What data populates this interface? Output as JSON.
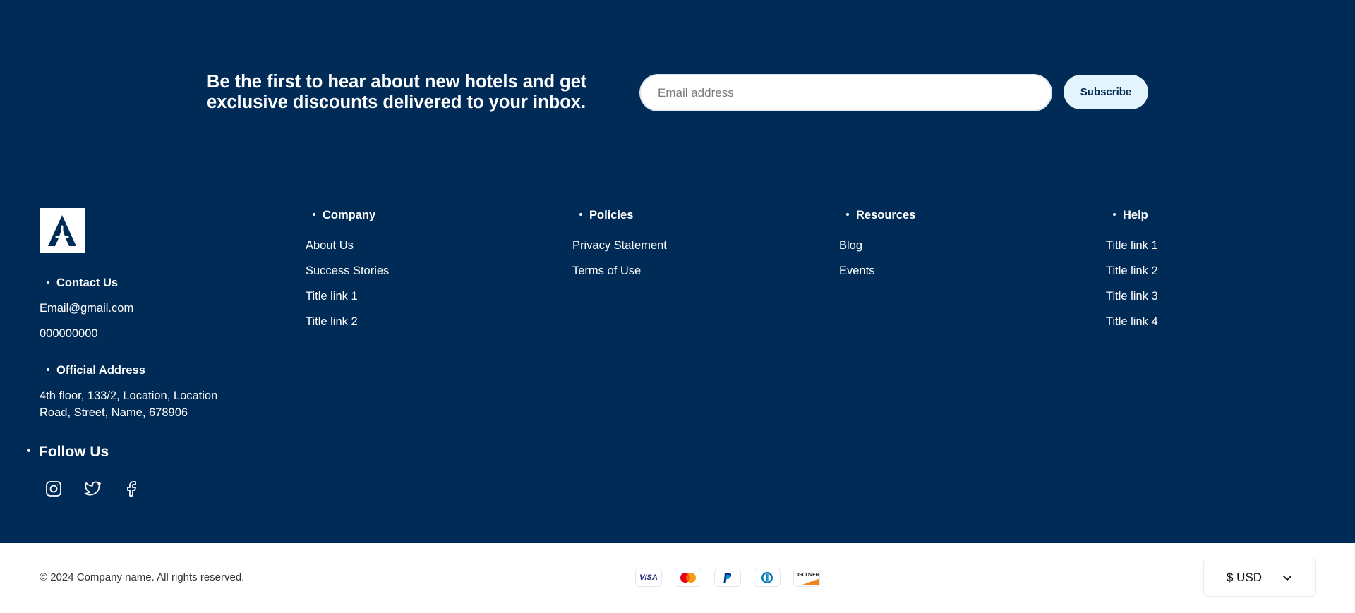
{
  "newsletter": {
    "heading_line1": "Be the first to hear about new hotels and get",
    "heading_line2": "exclusive discounts delivered to your inbox.",
    "email_placeholder": "Email address",
    "subscribe_label": "Subscribe"
  },
  "contact": {
    "title": "Contact Us",
    "email": "Email@gmail.com",
    "phone": "000000000"
  },
  "address": {
    "title": "Official Address",
    "line1": "4th floor, 133/2, Location, Location",
    "line2": "Road, Street, Name, 678906"
  },
  "follow": {
    "title": "Follow Us",
    "icons": [
      "instagram-icon",
      "twitter-icon",
      "facebook-icon"
    ]
  },
  "columns": [
    {
      "title": "Company",
      "links": [
        "About Us",
        "Success Stories",
        "Title link 1",
        "Title link 2"
      ]
    },
    {
      "title": "Policies",
      "links": [
        "Privacy Statement",
        "Terms of Use"
      ]
    },
    {
      "title": "Resources",
      "links": [
        "Blog",
        "Events"
      ]
    },
    {
      "title": "Help",
      "links": [
        "Title link 1",
        "Title link 2",
        "Title link 3",
        "Title link 4"
      ]
    }
  ],
  "bottom": {
    "copyright": "© 2024 Company name. All rights reserved.",
    "payment_methods": [
      "visa-icon",
      "mastercard-icon",
      "paypal-icon",
      "diners-icon",
      "discover-icon"
    ],
    "visa_text": "VISA",
    "discover_text": "DISCOVER",
    "currency": "$ USD"
  },
  "colors": {
    "footer_bg": "#002b56",
    "subscribe_bg": "#e3f4fd",
    "text_light": "#ffffff"
  }
}
